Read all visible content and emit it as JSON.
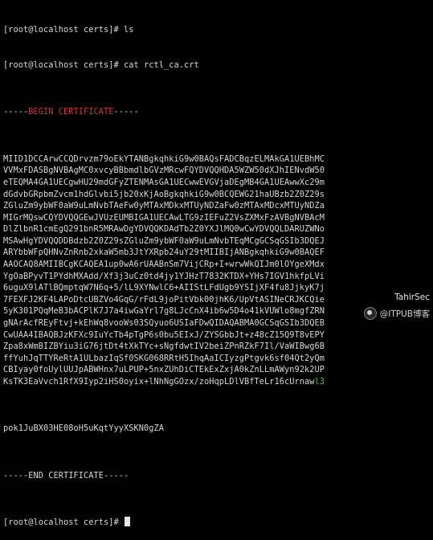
{
  "terminal": {
    "lines": [
      "[root@localhost certs]# ls",
      "[root@localhost certs]# cat rctl_ca.crt"
    ],
    "cert_header": {
      "prefix": "-----",
      "label": "BEGIN CERTIFICATE",
      "suffix": "-----"
    },
    "cert_body": [
      "MIID1DCCArwCCQDrvzm79oEkYTANBgkqhkiG9w0BAQsFADCBqzELMAkGA1UEBhMC",
      "VVMxFDASBgNVBAgMC0xvcyBBbmdlbGVzMRcwFQYDVQQHDA5WZW50dXJhIENvdW50",
      "eTEQMA4GA1UECgwHU29mdGFyZTENMAsGA1UECwwEVGVjaDEgMB4GA1UEAwwXc29m",
      "dGdvbGRpbmZvcm1hdGlvbi5jb20xKjAoBgkqhkiG9w0BCQEWG21haUBzb2Z0Z29s",
      "ZGluZm9ybWF0aW9uLmNvbTAeFw0yMTAxMDkxMTUyNDZaFw0zMTAxMDcxMTUyNDZa",
      "MIGrMQswCQYDVQQGEwJVUzEUMBIGA1UECAwLTG9zIEFuZ2VsZXMxFzAVBgNVBAcM",
      "DlZlbnR1cmEgQ291bnR5MRAwDgYDVQQKDAdTb2Z0YXJlMQ0wCwYDVQQLDARUZWNo",
      "MSAwHgYDVQQDDBdzb2Z0Z29sZGluZm9ybWF0aW9uLmNvbTEqMCgGCSqGSIb3DQEJ",
      "ARYbbWFpQHNvZnRnb2xkaW5mb3JtYXRpb24uY29tMIIBIjANBgkqhkiG9w0BAQEF",
      "AAOCAQ8AMIIBCgKCAQEA1up0wA6rUAABnSm7VijCRp+I+wrwWkQIJm0lOYgeXMdx",
      "YgOaBPyvT1PYdhMXAdd/Xf3j3uCz0td4jy1YJHzT7832KTDX+YHs7IGV1hkfpLVi",
      "6uguX9lATlBQmptqW7N6q+5/lL9XYNwlC6+AIIStLFdUgb9YSIjXF4fu8JjkyK7j",
      "7FEXFJ2KF4LAPoDtcUBZVo4GqG/rFdL9joPitVbk00jhK6/UpVtASINeCRJKCQie",
      "5yK301PQqMeB3bACPlK7J7a4iwGaYrl7g8LJcCnX4ib6w5D4o41kVUWlo8mgfZRN",
      "gNArAcfREyFtvj+kEhWq8vooWs03SQyuo6USIaFDwQIDAQABMA0GCSqGSIb3DQEB",
      "CwUAA4IBAQBJzKFXc9IuYcTb4pTgP6s0bu5EIxJ/ZYSGbbJt+z48cZ15Q9T8vEPY",
      "Zpa8xWmBIZBYiu3iG76jtDt4tXkTYc+sNgfdwtIV2beiZPnRZkF7Il/VaWIBwg6B",
      "ffYuhJqTTYReRtA1ULbazIqSf0SKG068RRtH5IhqAaICIyzgPtgvk6sf04Qt2yQm",
      "CBIyay0foUylUUJpABWHnx7uLPUP+5nxZUhDiCTEkExZxjA0kZnLLmAWyn92k2UP",
      "KsTK3EaVvch1RfX9Iyp2iHS0oyix+lNhNgGOzx/zoHqpLDlVBfTeLr16cUrnaw"
    ],
    "cert_body_tail": {
      "text": "l3",
      "color": "#4fc04f"
    },
    "cert_body_last": "pok1JuBX03HE08oH5uKqtYyyXSKN0gZA",
    "cert_footer": "-----END CERTIFICATE-----",
    "final_prompt": "[root@localhost certs]#",
    "colors": {
      "background": "#000000",
      "text": "#d8d8d8",
      "begin_label": "#c83c3c",
      "tail_green": "#4fc04f"
    }
  },
  "watermark": {
    "line1": "TahirSec",
    "line2": "@ITPUB博客"
  }
}
